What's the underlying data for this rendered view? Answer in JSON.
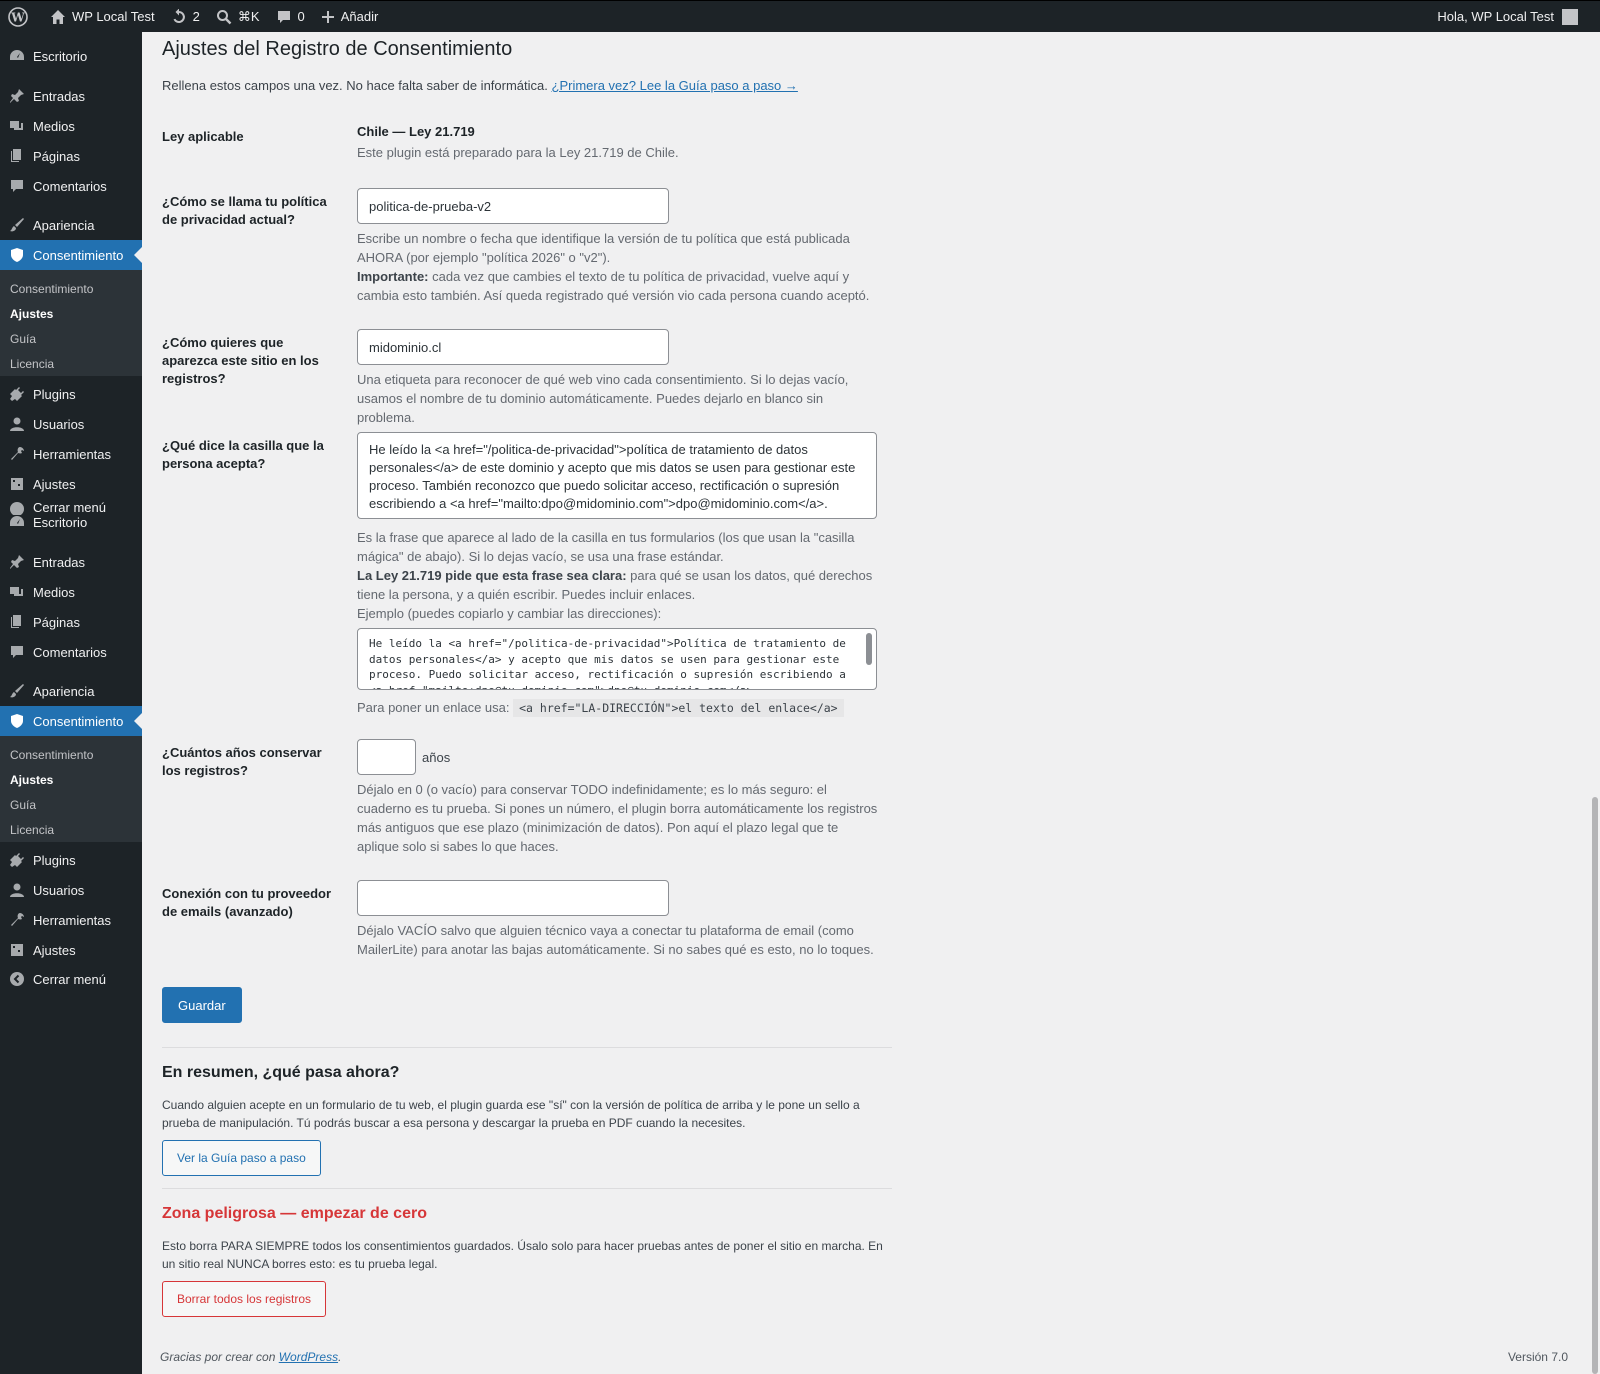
{
  "adminbar": {
    "site_name": "WP Local Test",
    "updates_count": "2",
    "search_shortcut": "⌘K",
    "comments_count": "0",
    "add_label": "Añadir",
    "greeting": "Hola, WP Local Test"
  },
  "sidebar": {
    "items_a": {
      "escritorio": "Escritorio",
      "entradas": "Entradas",
      "medios": "Medios",
      "paginas": "Páginas",
      "comentarios": "Comentarios",
      "apariencia": "Apariencia",
      "consentimiento": "Consentimiento",
      "sub_consentimiento": "Consentimiento",
      "sub_ajustes": "Ajustes",
      "sub_guia": "Guía",
      "sub_licencia": "Licencia",
      "plugins": "Plugins",
      "usuarios": "Usuarios",
      "herramientas": "Herramientas",
      "ajustes": "Ajustes",
      "cerrar": "Cerrar menú"
    },
    "items_b": {
      "escritorio": "Escritorio",
      "entradas": "Entradas",
      "medios": "Medios",
      "paginas": "Páginas",
      "comentarios": "Comentarios",
      "apariencia": "Apariencia",
      "consentimiento": "Consentimiento",
      "sub_consentimiento": "Consentimiento",
      "sub_ajustes": "Ajustes",
      "sub_guia": "Guía",
      "sub_licencia": "Licencia",
      "plugins": "Plugins",
      "usuarios": "Usuarios",
      "herramientas": "Herramientas",
      "ajustes": "Ajustes",
      "cerrar": "Cerrar menú"
    }
  },
  "page": {
    "title": "Ajustes del Registro de Consentimiento",
    "intro_text": "Rellena estos campos una vez. No hace falta saber de informática.",
    "intro_link": "¿Primera vez? Lee la Guía paso a paso →"
  },
  "law": {
    "label": "Ley aplicable",
    "value": "Chile — Ley 21.719",
    "desc": "Este plugin está preparado para la Ley 21.719 de Chile."
  },
  "policy": {
    "label": "¿Cómo se llama tu política de privacidad actual?",
    "value": "politica-de-prueba-v2",
    "desc_1": "Escribe un nombre o fecha que identifique la versión de tu política que está publicada AHORA (por ejemplo \"política 2026\" o \"v2\").",
    "desc_strong": "Importante:",
    "desc_2": " cada vez que cambies el texto de tu política de privacidad, vuelve aquí y cambia esto también. Así queda registrado qué versión vio cada persona cuando aceptó."
  },
  "site_label": {
    "label": "¿Cómo quieres que aparezca este sitio en los registros?",
    "value": "midominio.cl",
    "desc": "Una etiqueta para reconocer de qué web vino cada consentimiento. Si lo dejas vacío, usamos el nombre de tu dominio automáticamente. Puedes dejarlo en blanco sin problema."
  },
  "checkbox_text": {
    "label": "¿Qué dice la casilla que la persona acepta?",
    "value": "He leído la <a href=\"/politica-de-privacidad\">política de tratamiento de datos personales</a> de este dominio y acepto que mis datos se usen para gestionar este proceso. También reconozco que puedo solicitar acceso, rectificación o supresión escribiendo a <a href=\"mailto:dpo@midominio.com\">dpo@midominio.com</a>.",
    "desc_1": "Es la frase que aparece al lado de la casilla en tus formularios (los que usan la \"casilla mágica\" de abajo). Si lo dejas vacío, se usa una frase estándar.",
    "desc_strong": "La Ley 21.719 pide que esta frase sea clara:",
    "desc_2": " para qué se usan los datos, qué derechos tiene la persona, y a quién escribir. Puedes incluir enlaces.",
    "example_label": "Ejemplo (puedes copiarlo y cambiar las direcciones):",
    "example_code": "He leído la <a href=\"/politica-de-privacidad\">Política de tratamiento de datos personales</a> y acepto que mis datos se usen para gestionar este proceso. Puedo solicitar acceso, rectificación o supresión escribiendo a <a href=\"mailto:dpo@tu-dominio.com\">dpo@tu-dominio.com</a>.",
    "link_hint": "Para poner un enlace usa:",
    "link_code": "<a href=\"LA-DIRECCIÓN\">el texto del enlace</a>"
  },
  "retention": {
    "label": "¿Cuántos años conservar los registros?",
    "unit": "años",
    "desc": "Déjalo en 0 (o vacío) para conservar TODO indefinidamente; es lo más seguro: el cuaderno es tu prueba. Si pones un número, el plugin borra automáticamente los registros más antiguos que ese plazo (minimización de datos). Pon aquí el plazo legal que te aplique solo si sabes lo que haces."
  },
  "email_provider": {
    "label": "Conexión con tu proveedor de emails (avanzado)",
    "desc": "Déjalo VACÍO salvo que alguien técnico vaya a conectar tu plataforma de email (como MailerLite) para anotar las bajas automáticamente. Si no sabes qué es esto, no lo toques."
  },
  "save_button": "Guardar",
  "summary": {
    "title": "En resumen, ¿qué pasa ahora?",
    "text": "Cuando alguien acepte en un formulario de tu web, el plugin guarda ese \"sí\" con la versión de política de arriba y le pone un sello a prueba de manipulación. Tú podrás buscar a esa persona y descargar la prueba en PDF cuando la necesites.",
    "button": "Ver la Guía paso a paso"
  },
  "danger": {
    "title": "Zona peligrosa — empezar de cero",
    "text": "Esto borra PARA SIEMPRE todos los consentimientos guardados. Úsalo solo para hacer pruebas antes de poner el sitio en marcha. En un sitio real NUNCA borres esto: es tu prueba legal.",
    "button": "Borrar todos los registros"
  },
  "footer": {
    "thanks": "Gracias por crear con ",
    "link": "WordPress",
    "period": ".",
    "version": "Versión 7.0"
  },
  "colors": {
    "accent": "#2271b1",
    "danger": "#d63638",
    "sidebar": "#1d2327"
  }
}
